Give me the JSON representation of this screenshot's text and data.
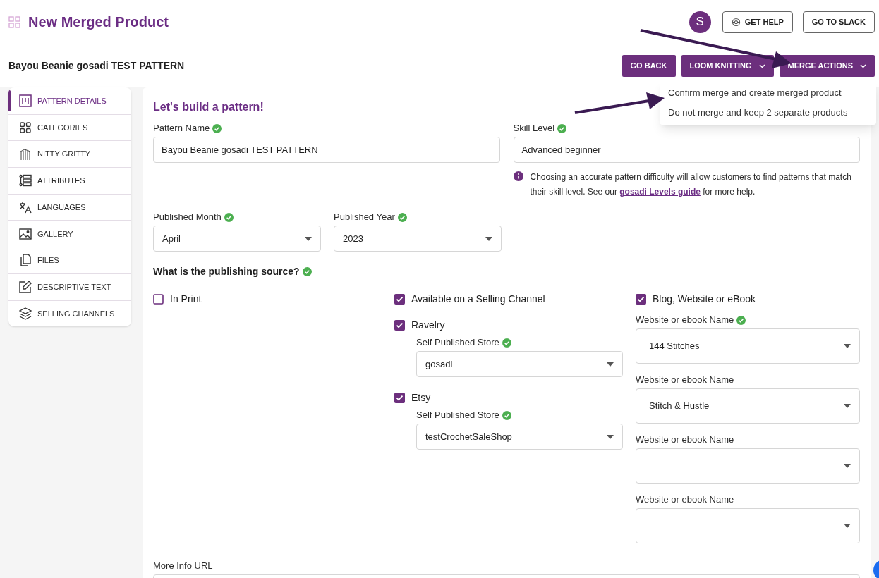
{
  "header": {
    "title": "New Merged Product",
    "avatar_initial": "S",
    "buttons": [
      {
        "label": "GET HELP",
        "kind": "help"
      },
      {
        "label": "GO TO SLACK",
        "kind": "plain"
      }
    ]
  },
  "product_title": "Bayou Beanie gosadi TEST PATTERN",
  "actions": [
    {
      "label": "GO BACK",
      "kind": "button"
    },
    {
      "label": "LOOM KNITTING",
      "kind": "dropdown"
    },
    {
      "label": "MERGE ACTIONS",
      "kind": "dropdown"
    }
  ],
  "merge_menu": {
    "open": true,
    "items": [
      "Confirm merge and create merged product",
      "Do not merge and keep 2 separate products"
    ]
  },
  "sidebar": {
    "items": [
      {
        "label": "PATTERN DETAILS",
        "selected": true
      },
      {
        "label": "CATEGORIES",
        "selected": false
      },
      {
        "label": "NITTY GRITTY",
        "selected": false
      },
      {
        "label": "ATTRIBUTES",
        "selected": false
      },
      {
        "label": "LANGUAGES",
        "selected": false
      },
      {
        "label": "GALLERY",
        "selected": false
      },
      {
        "label": "FILES",
        "selected": false
      },
      {
        "label": "DESCRIPTIVE TEXT",
        "selected": false
      },
      {
        "label": "SELLING CHANNELS",
        "selected": false
      }
    ]
  },
  "form": {
    "heading": "Let's build a pattern!",
    "pattern_name": {
      "label": "Pattern Name",
      "valid": true,
      "value": "Bayou Beanie gosadi TEST PATTERN"
    },
    "skill_level": {
      "label": "Skill Level",
      "valid": true,
      "value": "Advanced beginner"
    },
    "skill_info": {
      "before": "Choosing an accurate pattern difficulty will allow customers to find patterns that match their skill level. See our",
      "link": "gosadi Levels guide",
      "after": "for more help."
    },
    "published_month": {
      "label": "Published Month",
      "valid": true,
      "value": "April"
    },
    "published_year": {
      "label": "Published Year",
      "valid": true,
      "value": "2023"
    },
    "publishing": {
      "heading": "What is the publishing source?",
      "valid": true,
      "in_print": {
        "label": "In Print",
        "checked": false
      },
      "selling_channel": {
        "label": "Available on a Selling Channel",
        "checked": true,
        "channels": [
          {
            "label": "Ravelry",
            "checked": true,
            "store_label": "Self Published Store",
            "store_valid": true,
            "store_value": "gosadi"
          },
          {
            "label": "Etsy",
            "checked": true,
            "store_label": "Self Published Store",
            "store_valid": true,
            "store_value": "testCrochetSaleShop"
          }
        ]
      },
      "blog": {
        "label": "Blog, Website or eBook",
        "checked": true,
        "sites": [
          {
            "label": "Website or ebook Name",
            "valid": true,
            "value": "144 Stitches"
          },
          {
            "label": "Website or ebook Name",
            "valid": false,
            "value": "Stitch & Hustle"
          },
          {
            "label": "Website or ebook Name",
            "valid": false
          },
          {
            "label": "Website or ebook Name",
            "valid": false
          }
        ]
      }
    },
    "more_info_url": {
      "label": "More Info URL"
    }
  }
}
